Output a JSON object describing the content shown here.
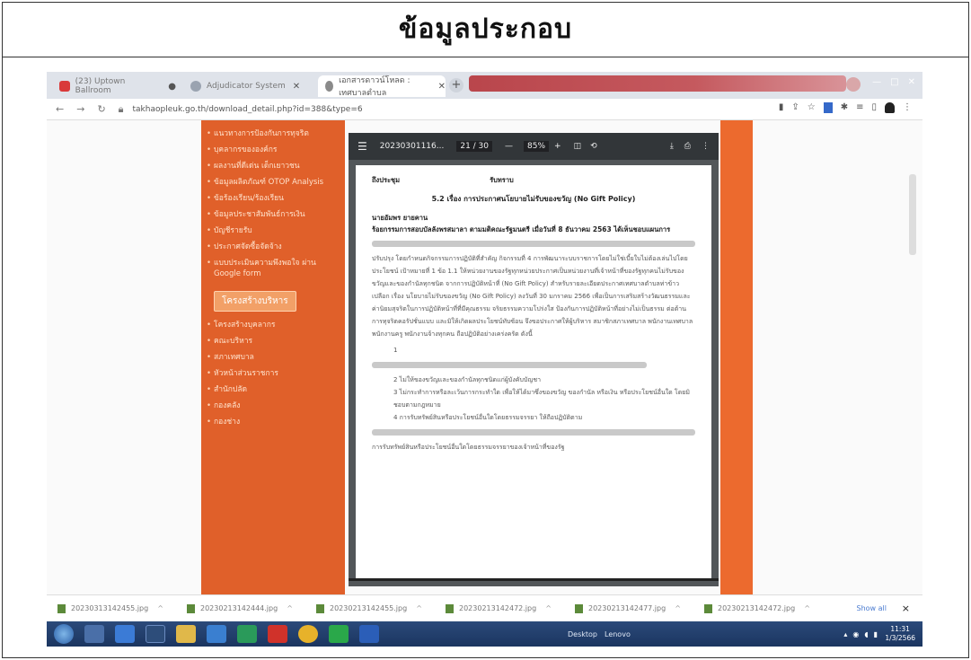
{
  "page_title": "ข้อมูลประกอบ",
  "browser": {
    "tabs": [
      {
        "label": "(23) Uptown Ballroom"
      },
      {
        "label": "Adjudicator System"
      },
      {
        "label": "เอกสารดาวน์โหลด : เทศบาลตำบล"
      }
    ],
    "new_tab": "+",
    "url": "takhaopleuk.go.th/download_detail.php?id=388&type=6"
  },
  "pdf": {
    "filename": "20230301116...",
    "page": "21 / 30",
    "zoom": "85%",
    "to_label": "ถึงประชุม",
    "to_value": "รับทราบ",
    "heading": "5.2 เรื่อง การประกาศนโยบายไม่รับของขวัญ (No Gift Policy)",
    "line1": "นายอัมพร  ยายคาน",
    "line2": "ร้อยกรรมการสอบบัลลังพรสมาลา   ตามมติคณะรัฐมนตรี เมื่อวันที่ 8 ธันวาคม 2563  ได้เห็นชอบแผนการ",
    "para": "ปรับปรุง โดยกำหนดกิจกรรมการปฏิบัติที่สำคัญ กิจกรรมที่ 4 การพัฒนาระบบราชการโดยไม่ใช่เบี้ยใบไม่ต้องเล่นไปโดยประโยชน์ เป้าหมายที่ 1 ข้อ 1.1 ให้หน่วยงานของรัฐทุกหน่วยประกาศเป็นหน่วยงานที่เจ้าหน้าที่ของรัฐทุกคนไม่รับของขวัญและของกำนัลทุกชนิด จากการปฏิบัติหน้าที่ (No Gift Policy) สำหรับรายละเอียดประกาศเทศบาลตำบลท่าข้าวเปลือก เรื่อง นโยบายไม่รับของขวัญ (No Gift Policy) ลงวันที่ 30 มกราคม 2566 เพื่อเป็นการเสริมสร้างวัฒนธรรมและค่านิยมสุจริตในการปฏิบัติหน้าที่ที่มีคุณธรรม จริยธรรมความโปร่งใส ป้องกันการปฏิบัติหน้าที่อย่างไม่เป็นธรรม ต่อต้านการทุจริตคอรัปชั่นแบบ และมิให้เกิดผลประโยชน์ทับซ้อน จึงขอประกาศให้ผู้บริหาร สมาชิกสภาเทศบาล พนักงานเทศบาล พนักงานครู พนักงานจ้างทุกคน ถือปฏิบัติอย่างเคร่งครัด ดังนี้",
    "item1": "1",
    "item2": "2   ไม่ให้ของขวัญและของกำนัลทุกชนิดแก่ผู้บังคับบัญชา",
    "item3": "3   ไม่กระทำการหรือละเว้นการกระทำใด เพื่อให้ได้มาซึ่งของขวัญ ของกำนัล หรือเงิน หรือประโยชน์อื่นใด โดยมิชอบตามกฎหมาย",
    "item4": "4   การรับทรัพย์สินหรือประโยชน์อื่นใดโดยธรรมจรรยา ให้ถือปฏิบัติตาม",
    "item4b": "การรับทรัพย์สินหรือประโยชน์อื่นใดโดยธรรมจรรยาของเจ้าหน้าที่ของรัฐ"
  },
  "sidebar": {
    "items_top": [
      "แนวทางการป้องกันการทุจริต",
      "บุคลากรขององค์กร",
      "ผลงานที่ดีเด่น เด็กเยาวชน",
      "ข้อมูลผลิตภัณฑ์ OTOP Analysis",
      "ข้อร้องเรียน/ร้องเรียน",
      "ข้อมูลประชาสัมพันธ์การเงิน",
      "บัญชีรายรับ",
      "ประกาศจัดซื้อจัดจ้าง",
      "แบบประเมินความพึงพอใจ ผ่าน Google form"
    ],
    "section_heading": "โครงสร้างบริหาร",
    "items_bottom": [
      "โครงสร้างบุคลากร",
      "คณะบริหาร",
      "สภาเทศบาล",
      "หัวหน้าส่วนราชการ",
      "สำนักปลัด",
      "กองคลัง",
      "กองช่าง"
    ]
  },
  "downloads": {
    "files": [
      "20230313142455.jpg",
      "20230213142444.jpg",
      "20230213142455.jpg",
      "20230213142472.jpg",
      "20230213142477.jpg",
      "20230213142472.jpg"
    ],
    "show_all": "Show all",
    "close": "×"
  },
  "taskbar": {
    "desktop": "Desktop",
    "lenovo": "Lenovo",
    "time": "11:31",
    "date": "1/3/2566"
  }
}
